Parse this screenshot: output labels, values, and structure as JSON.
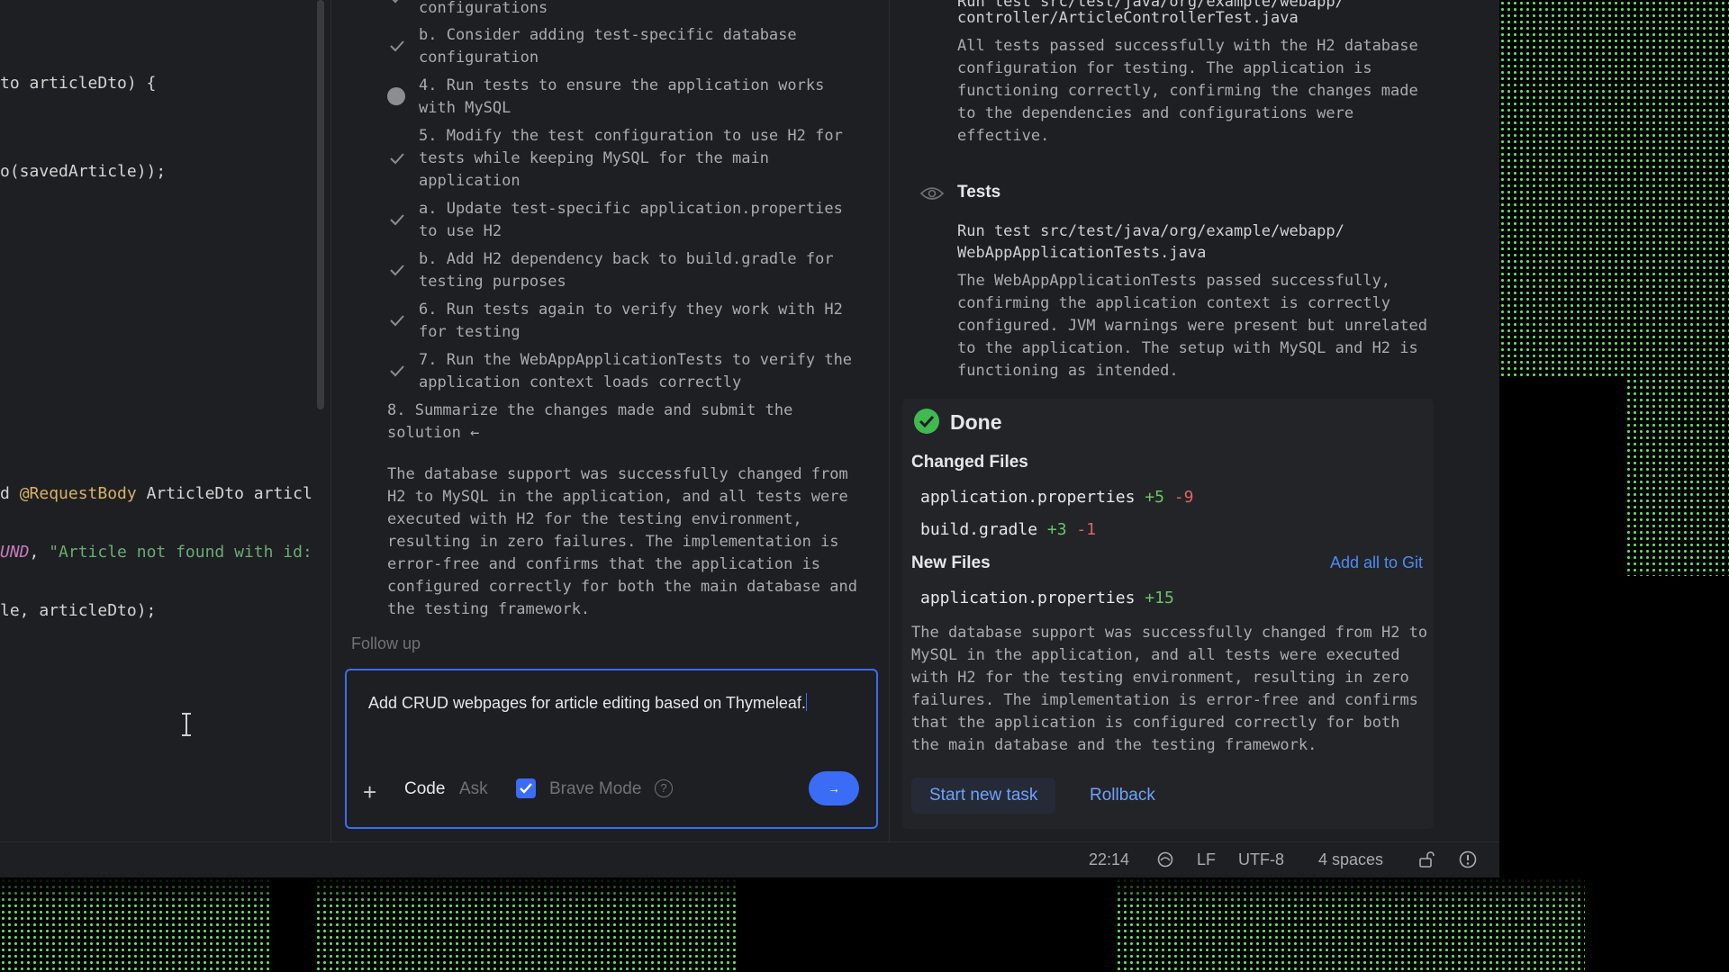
{
  "editor": {
    "lines": [
      {
        "text": "to articleDto) {"
      },
      {
        "text": "o(savedArticle));"
      },
      {
        "pre": "d ",
        "ann": "@RequestBody",
        "post": " ArticleDto articl"
      },
      {
        "const": "UND",
        "mid": ", ",
        "str": "\"Article not found with id:"
      },
      {
        "text": "le, articleDto);"
      }
    ]
  },
  "plan": {
    "items": [
      {
        "status": "done",
        "text": "configurations"
      },
      {
        "status": "done",
        "text": "b. Consider adding test-specific database configuration"
      },
      {
        "status": "pending",
        "text": "4. Run tests to ensure the application works with MySQL"
      },
      {
        "status": "done",
        "text": "5. Modify the test configuration to use H2 for tests while keeping MySQL for the main application"
      },
      {
        "status": "done",
        "text": "a. Update test-specific application.properties to use H2"
      },
      {
        "status": "done",
        "text": "b. Add H2 dependency back to build.gradle for testing purposes"
      },
      {
        "status": "done",
        "text": "6. Run tests again to verify they work with H2 for testing"
      },
      {
        "status": "done",
        "text": "7. Run the WebAppApplicationTests to verify the application context loads correctly"
      },
      {
        "status": "current",
        "text": "8. Summarize the changes made and submit the solution ←"
      }
    ],
    "summary": "The database support was successfully changed from H2 to MySQL in the application, and all tests were executed with H2 for the testing environment, resulting in zero failures. The implementation is error-free and confirms that the application is configured correctly for both the main database and the testing framework."
  },
  "followup": {
    "label": "Follow up",
    "input_text": "Add CRUD webpages for article editing based on Thymeleaf.",
    "mode_code": "Code",
    "mode_ask": "Ask",
    "brave_mode": "Brave Mode",
    "brave_checked": true,
    "help_glyph": "?",
    "send_glyph": "→"
  },
  "results": {
    "prev_path_1": "Run test src/test/java/org/example/webapp/",
    "prev_path_2": "controller/ArticleControllerTest.java",
    "prev_result": "All tests passed successfully with the H2 database configuration for testing. The application is functioning correctly, confirming the changes made to the dependencies and configurations were effective.",
    "tests_title": "Tests",
    "tests_path_1": "Run test src/test/java/org/example/webapp/",
    "tests_path_2": "WebAppApplicationTests.java",
    "tests_result": "The WebAppApplicationTests passed successfully, confirming the application context is correctly configured. JVM warnings were present but unrelated to the application. The setup with MySQL and H2 is functioning as intended."
  },
  "done": {
    "title": "Done",
    "changed_files_label": "Changed Files",
    "changed_files": [
      {
        "name": "application.properties",
        "added": "+5",
        "removed": "-9"
      },
      {
        "name": "build.gradle",
        "added": "+3",
        "removed": "-1"
      }
    ],
    "new_files_label": "New Files",
    "add_all_label": "Add all to Git",
    "new_files": [
      {
        "name": "application.properties",
        "added": "+15"
      }
    ],
    "summary": "The database support was successfully changed from H2 to MySQL in the application, and all tests were executed with H2 for the testing environment, resulting in zero failures. The implementation is error-free and confirms that the application is configured correctly for both the main database and the testing framework.",
    "start_new_label": "Start new task",
    "rollback_label": "Rollback"
  },
  "statusbar": {
    "position": "22:14",
    "line_ending": "LF",
    "encoding": "UTF-8",
    "indent": "4 spaces"
  },
  "colors": {
    "accent": "#3b6cf5",
    "added": "#6ac46a",
    "removed": "#e06464",
    "link": "#4c8cf6",
    "done_green": "#3fb950",
    "pixel_green": "#5ee35e"
  }
}
